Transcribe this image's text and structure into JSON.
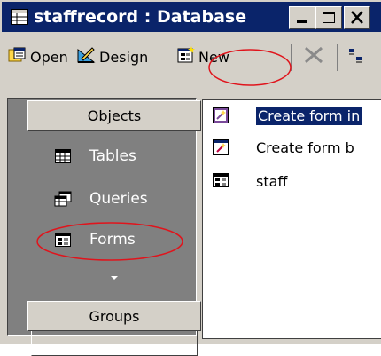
{
  "window": {
    "title": "staffrecord : Database",
    "icons": {
      "app": "database-window-icon",
      "minimize": "minimize-icon",
      "maximize": "maximize-icon",
      "close": "close-icon"
    }
  },
  "toolbar": {
    "open_label": "Open",
    "design_label": "Design",
    "new_label": "New",
    "icons": [
      "open-icon",
      "design-icon",
      "new-form-icon",
      "delete-icon",
      "large-icons-view-icon"
    ]
  },
  "objects_bar": {
    "header": "Objects",
    "items": [
      {
        "label": "Tables",
        "icon": "tables-icon"
      },
      {
        "label": "Queries",
        "icon": "queries-icon"
      },
      {
        "label": "Forms",
        "icon": "forms-icon",
        "selected": true
      }
    ],
    "more_icon": "chevron-down-icon",
    "groups_label": "Groups"
  },
  "list": {
    "items": [
      {
        "label": "Create form in",
        "icon": "wizard-icon",
        "selected": true
      },
      {
        "label": "Create form b",
        "icon": "wizard-icon",
        "selected": false
      },
      {
        "label": "staff",
        "icon": "form-icon",
        "selected": false
      }
    ]
  },
  "colors": {
    "title_bar": "#0a246a",
    "face": "#d4d0c8",
    "pane": "#808080",
    "annotation": "#e0141c"
  }
}
